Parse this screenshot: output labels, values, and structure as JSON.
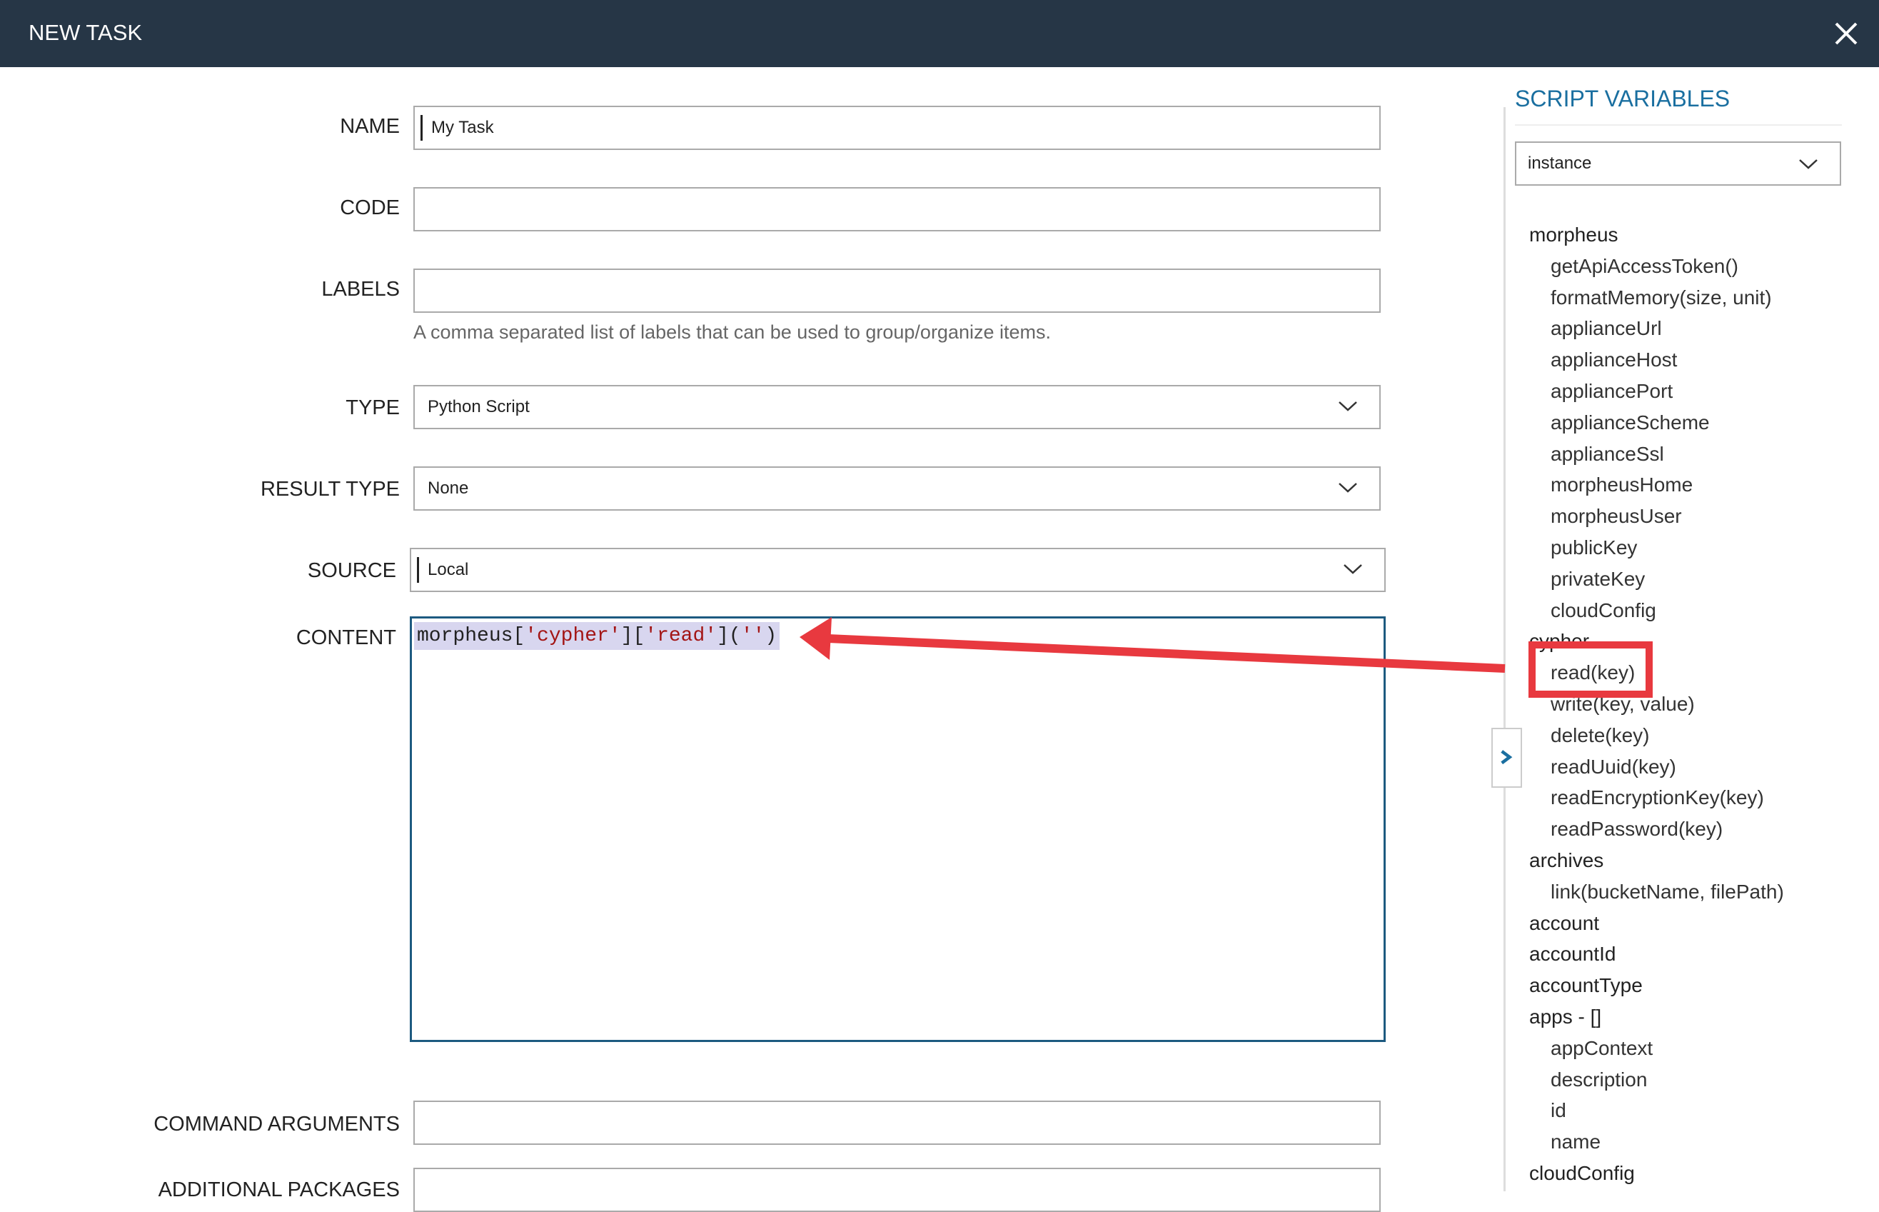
{
  "header": {
    "title": "NEW TASK",
    "close_icon": "close-icon"
  },
  "form": {
    "name": {
      "label": "NAME",
      "value": "My Task"
    },
    "code": {
      "label": "CODE",
      "value": ""
    },
    "labels": {
      "label": "LABELS",
      "value": "",
      "help": "A comma separated list of labels that can be used to group/organize items."
    },
    "type": {
      "label": "TYPE",
      "value": "Python Script"
    },
    "result_type": {
      "label": "RESULT TYPE",
      "value": "None"
    },
    "source": {
      "label": "SOURCE",
      "value": "Local"
    },
    "content": {
      "label": "CONTENT",
      "code_parts": [
        "morpheus[",
        "'cypher'",
        "][",
        "'read'",
        "](",
        "''",
        ")"
      ]
    },
    "command_arguments": {
      "label": "COMMAND ARGUMENTS",
      "value": ""
    },
    "additional_packages": {
      "label": "ADDITIONAL PACKAGES",
      "value": ""
    }
  },
  "sidebar": {
    "title": "SCRIPT VARIABLES",
    "selected": "instance",
    "items": [
      {
        "text": "morpheus",
        "child": false
      },
      {
        "text": "getApiAccessToken()",
        "child": true
      },
      {
        "text": "formatMemory(size, unit)",
        "child": true
      },
      {
        "text": "applianceUrl",
        "child": true
      },
      {
        "text": "applianceHost",
        "child": true
      },
      {
        "text": "appliancePort",
        "child": true
      },
      {
        "text": "applianceScheme",
        "child": true
      },
      {
        "text": "applianceSsl",
        "child": true
      },
      {
        "text": "morpheusHome",
        "child": true
      },
      {
        "text": "morpheusUser",
        "child": true
      },
      {
        "text": "publicKey",
        "child": true
      },
      {
        "text": "privateKey",
        "child": true
      },
      {
        "text": "cloudConfig",
        "child": true
      },
      {
        "text": "cypher",
        "child": false
      },
      {
        "text": "read(key)",
        "child": true
      },
      {
        "text": "write(key, value)",
        "child": true
      },
      {
        "text": "delete(key)",
        "child": true
      },
      {
        "text": "readUuid(key)",
        "child": true
      },
      {
        "text": "readEncryptionKey(key)",
        "child": true
      },
      {
        "text": "readPassword(key)",
        "child": true
      },
      {
        "text": "archives",
        "child": false
      },
      {
        "text": "link(bucketName, filePath)",
        "child": true
      },
      {
        "text": "account",
        "child": false
      },
      {
        "text": "accountId",
        "child": false
      },
      {
        "text": "accountType",
        "child": false
      },
      {
        "text": "apps - []",
        "child": false
      },
      {
        "text": "appContext",
        "child": true
      },
      {
        "text": "description",
        "child": true
      },
      {
        "text": "id",
        "child": true
      },
      {
        "text": "name",
        "child": true
      },
      {
        "text": "cloudConfig",
        "child": false
      }
    ]
  },
  "colors": {
    "header": "#263646",
    "accent": "#1a6fa0",
    "annotation": "#e8393f",
    "highlight": "#d8d6ef"
  }
}
